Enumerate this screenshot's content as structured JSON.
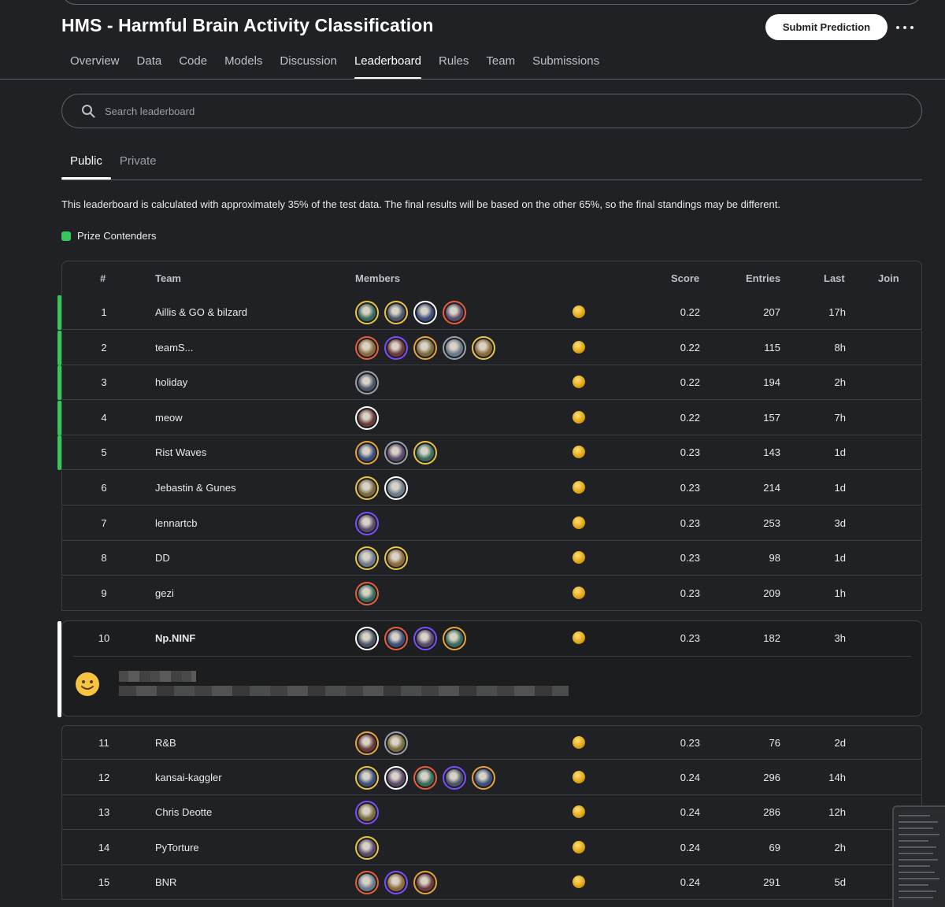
{
  "header": {
    "title": "HMS - Harmful Brain Activity Classification",
    "submit_label": "Submit Prediction"
  },
  "nav": {
    "tabs": [
      "Overview",
      "Data",
      "Code",
      "Models",
      "Discussion",
      "Leaderboard",
      "Rules",
      "Team",
      "Submissions"
    ],
    "active": "Leaderboard"
  },
  "search": {
    "placeholder": "Search leaderboard"
  },
  "subtabs": {
    "public": "Public",
    "private": "Private",
    "active": "Public"
  },
  "notice": "This leaderboard is calculated with approximately 35% of the test data. The final results will be based on the other 65%, so the final standings may be different.",
  "legend": {
    "label": "Prize Contenders",
    "color": "#34c759"
  },
  "table": {
    "headers": {
      "rank": "#",
      "team": "Team",
      "members": "Members",
      "score": "Score",
      "entries": "Entries",
      "last": "Last",
      "join": "Join"
    },
    "rows": [
      {
        "rank": "1",
        "team": "Aillis & GO & bilzard",
        "members": 4,
        "score": "0.22",
        "entries": "207",
        "last": "17h",
        "prize": true
      },
      {
        "rank": "2",
        "team": "teamS...",
        "members": 5,
        "score": "0.22",
        "entries": "115",
        "last": "8h",
        "prize": true
      },
      {
        "rank": "3",
        "team": "holiday",
        "members": 1,
        "score": "0.22",
        "entries": "194",
        "last": "2h",
        "prize": true
      },
      {
        "rank": "4",
        "team": "meow",
        "members": 1,
        "score": "0.22",
        "entries": "157",
        "last": "7h",
        "prize": true
      },
      {
        "rank": "5",
        "team": "Rist Waves",
        "members": 3,
        "score": "0.23",
        "entries": "143",
        "last": "1d",
        "prize": true
      },
      {
        "rank": "6",
        "team": "Jebastin & Gunes",
        "members": 2,
        "score": "0.23",
        "entries": "214",
        "last": "1d",
        "prize": false
      },
      {
        "rank": "7",
        "team": "lennartcb",
        "members": 1,
        "score": "0.23",
        "entries": "253",
        "last": "3d",
        "prize": false
      },
      {
        "rank": "8",
        "team": "DD",
        "members": 2,
        "score": "0.23",
        "entries": "98",
        "last": "1d",
        "prize": false
      },
      {
        "rank": "9",
        "team": "gezi",
        "members": 1,
        "score": "0.23",
        "entries": "209",
        "last": "1h",
        "prize": false
      }
    ],
    "user_row": {
      "rank": "10",
      "team": "Np.NINF",
      "members": 4,
      "score": "0.23",
      "entries": "182",
      "last": "3h"
    },
    "rows_after": [
      {
        "rank": "11",
        "team": "R&B",
        "members": 2,
        "score": "0.23",
        "entries": "76",
        "last": "2d"
      },
      {
        "rank": "12",
        "team": "kansai-kaggler",
        "members": 5,
        "score": "0.24",
        "entries": "296",
        "last": "14h"
      },
      {
        "rank": "13",
        "team": "Chris Deotte",
        "members": 1,
        "score": "0.24",
        "entries": "286",
        "last": "12h"
      },
      {
        "rank": "14",
        "team": "PyTorture",
        "members": 1,
        "score": "0.24",
        "entries": "69",
        "last": "2h"
      },
      {
        "rank": "15",
        "team": "BNR",
        "members": 3,
        "score": "0.24",
        "entries": "291",
        "last": "5d"
      }
    ]
  },
  "icons": {
    "more": "more-horizontal-icon",
    "search": "search-icon",
    "medal": "gold-medal-icon",
    "smiley": "smiley-icon"
  },
  "colors": {
    "background": "#202124",
    "prize": "#34c759",
    "medal": "#e0a410"
  }
}
